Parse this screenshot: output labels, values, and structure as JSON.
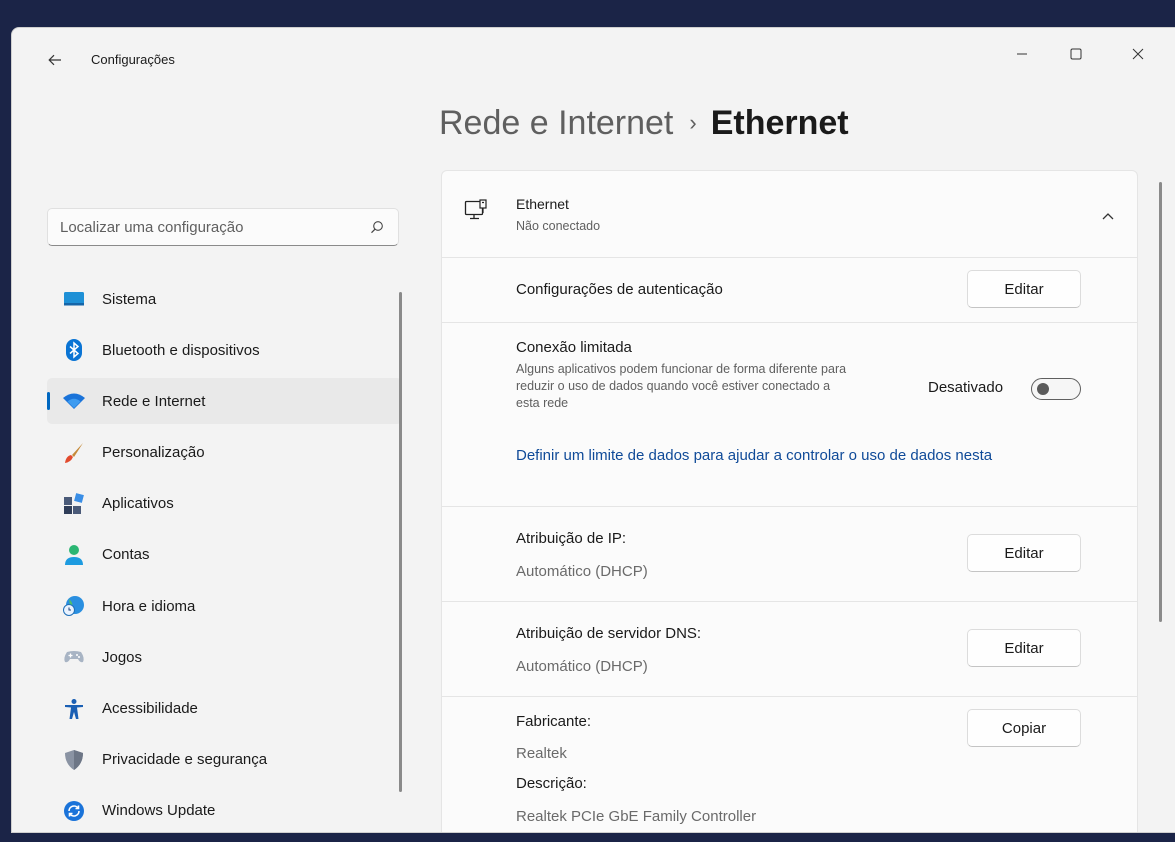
{
  "window": {
    "title": "Configurações"
  },
  "breadcrumb": {
    "parent": "Rede e Internet",
    "separator": "›",
    "current": "Ethernet"
  },
  "search": {
    "placeholder": "Localizar uma configuração"
  },
  "sidebar": {
    "items": [
      {
        "label": "Sistema",
        "icon": "monitor-icon",
        "active": false
      },
      {
        "label": "Bluetooth e dispositivos",
        "icon": "bluetooth-icon",
        "active": false
      },
      {
        "label": "Rede e Internet",
        "icon": "wifi-icon",
        "active": true
      },
      {
        "label": "Personalização",
        "icon": "brush-icon",
        "active": false
      },
      {
        "label": "Aplicativos",
        "icon": "apps-icon",
        "active": false
      },
      {
        "label": "Contas",
        "icon": "person-icon",
        "active": false
      },
      {
        "label": "Hora e idioma",
        "icon": "globe-clock-icon",
        "active": false
      },
      {
        "label": "Jogos",
        "icon": "gamepad-icon",
        "active": false
      },
      {
        "label": "Acessibilidade",
        "icon": "accessibility-icon",
        "active": false
      },
      {
        "label": "Privacidade e segurança",
        "icon": "shield-icon",
        "active": false
      },
      {
        "label": "Windows Update",
        "icon": "update-icon",
        "active": false
      }
    ]
  },
  "ethernet": {
    "title": "Ethernet",
    "status": "Não conectado",
    "auth": {
      "label": "Configurações de autenticação",
      "button": "Editar"
    },
    "metered": {
      "label": "Conexão limitada",
      "description": "Alguns aplicativos podem funcionar de forma diferente para reduzir o uso de dados quando você estiver conectado a esta rede",
      "toggle_label": "Desativado",
      "toggle_on": false,
      "link": "Definir um limite de dados para ajudar a controlar o uso de dados nesta"
    },
    "ip": {
      "label": "Atribuição de IP:",
      "value": "Automático (DHCP)",
      "button": "Editar"
    },
    "dns": {
      "label": "Atribuição de servidor DNS:",
      "value": "Automático (DHCP)",
      "button": "Editar"
    },
    "properties": {
      "manufacturer_label": "Fabricante:",
      "manufacturer": "Realtek",
      "description_label": "Descrição:",
      "description": "Realtek PCIe GbE Family Controller",
      "button": "Copiar"
    }
  },
  "colors": {
    "accent": "#0067c0",
    "link": "#0f4a98",
    "background": "#f3f3f3",
    "card": "#fbfbfb"
  }
}
